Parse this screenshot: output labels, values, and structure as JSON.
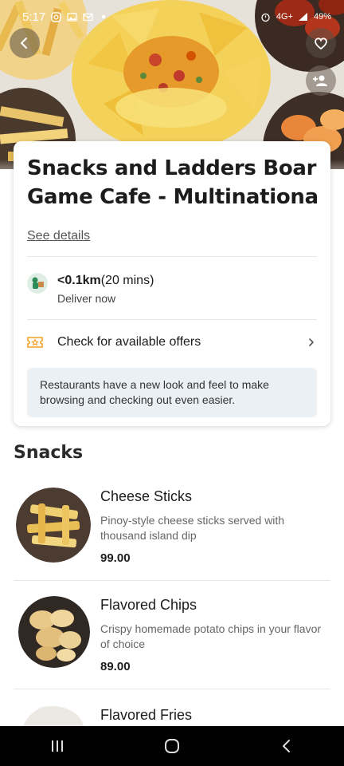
{
  "status_bar": {
    "time": "5:17",
    "battery": "49%",
    "network": "4G+"
  },
  "store": {
    "name_line1": "Snacks and Ladders Board",
    "name_line2": "Game Cafe - Multinational ...",
    "see_details": "See details",
    "distance": "<0.1km",
    "eta": "(20 mins)",
    "deliver_status": "Deliver now",
    "offers_label": "Check for available offers",
    "notice": "Restaurants have a new look and feel to make browsing and checking out even easier."
  },
  "section": {
    "title": "Snacks"
  },
  "menu_items": [
    {
      "name": "Cheese Sticks",
      "description": "Pinoy-style cheese sticks served with thousand island dip",
      "price": "99.00"
    },
    {
      "name": "Flavored Chips",
      "description": "Crispy homemade potato chips in your flavor of choice",
      "price": "89.00"
    },
    {
      "name": "Flavored Fries"
    }
  ],
  "icons": {
    "back": "back-arrow-icon",
    "favorite": "heart-icon",
    "group_order": "add-group-icon",
    "offers": "ticket-icon",
    "chevron": "chevron-right-icon"
  },
  "colors": {
    "notice_bg": "#ebf0f5",
    "offer_icon": "#f0a020",
    "nav_bar": "#000000"
  }
}
